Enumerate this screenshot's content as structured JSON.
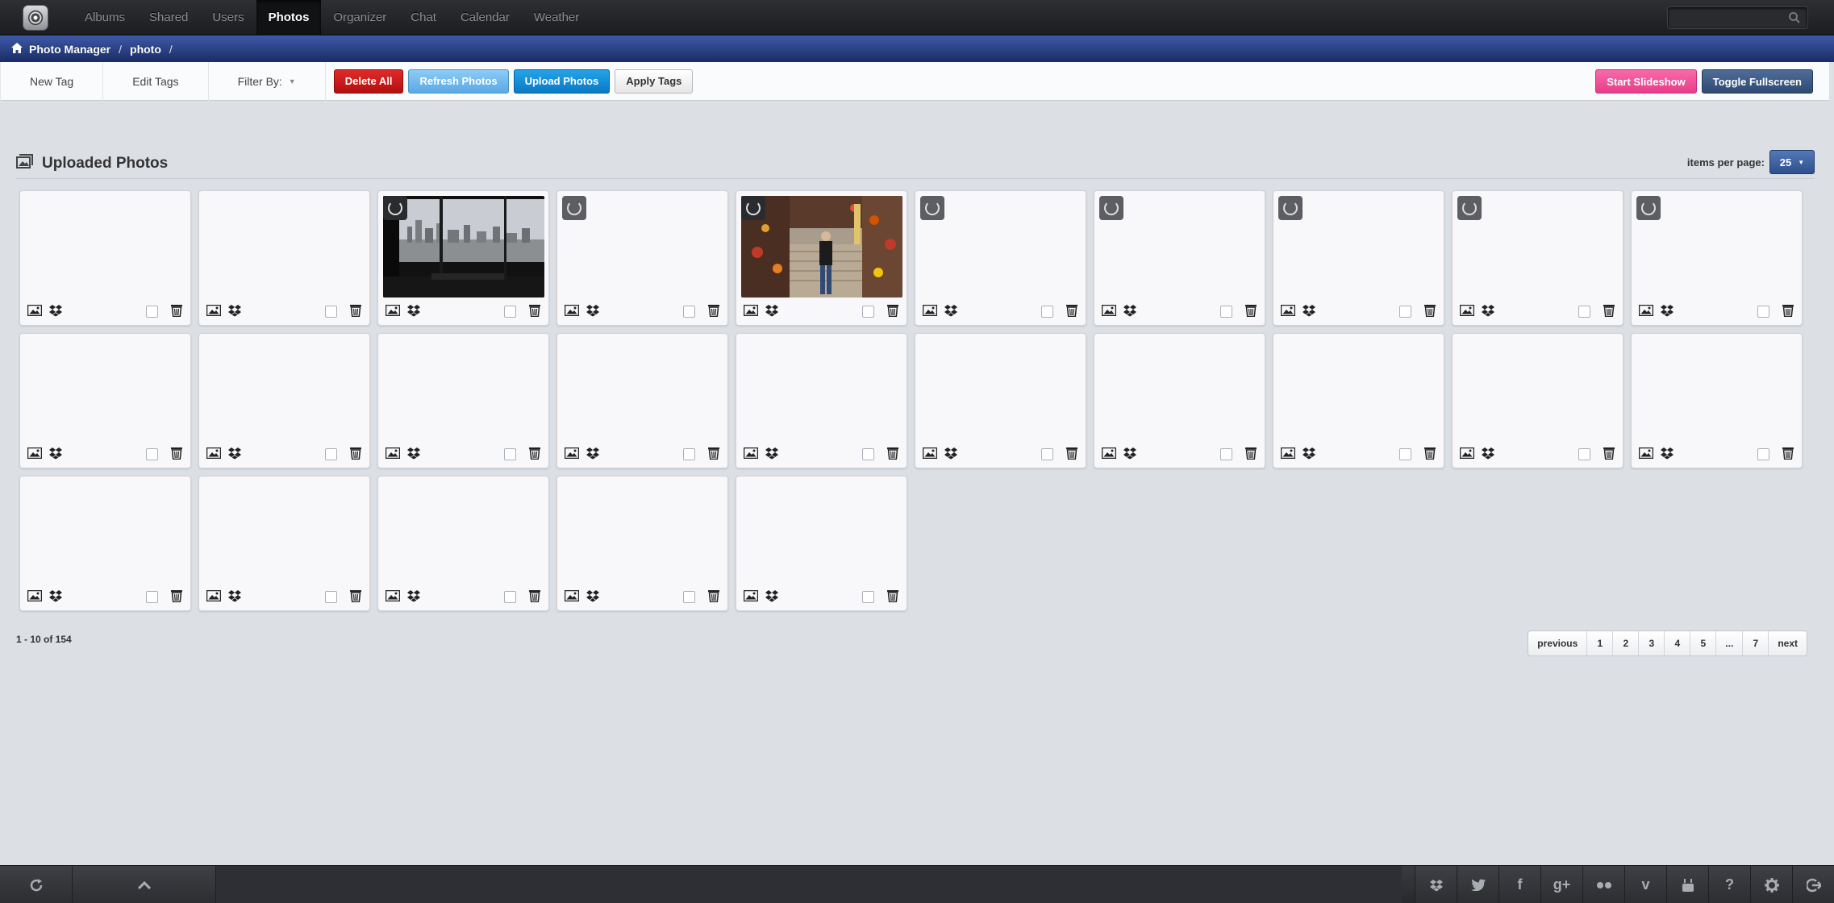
{
  "nav": {
    "items": [
      {
        "label": "Albums",
        "active": false
      },
      {
        "label": "Shared",
        "active": false
      },
      {
        "label": "Users",
        "active": false
      },
      {
        "label": "Photos",
        "active": true
      },
      {
        "label": "Organizer",
        "active": false
      },
      {
        "label": "Chat",
        "active": false
      },
      {
        "label": "Calendar",
        "active": false
      },
      {
        "label": "Weather",
        "active": false
      }
    ],
    "search_value": ""
  },
  "breadcrumb": {
    "root": "Photo Manager",
    "current": "photo",
    "sep": "/"
  },
  "toolbar": {
    "new_tag": "New Tag",
    "edit_tags": "Edit Tags",
    "filter_by": "Filter By:",
    "delete_all": "Delete All",
    "refresh_photos": "Refresh Photos",
    "upload_photos": "Upload Photos",
    "apply_tags": "Apply Tags",
    "start_slideshow": "Start Slideshow",
    "toggle_fullscreen": "Toggle Fullscreen"
  },
  "section": {
    "title": "Uploaded Photos",
    "items_per_page_label": "items per page:",
    "items_per_page_value": "25"
  },
  "cards": [
    {
      "state": "empty"
    },
    {
      "state": "empty"
    },
    {
      "state": "photo-harbor"
    },
    {
      "state": "loading"
    },
    {
      "state": "photo-street"
    },
    {
      "state": "loading"
    },
    {
      "state": "loading"
    },
    {
      "state": "loading"
    },
    {
      "state": "loading"
    },
    {
      "state": "loading"
    },
    {
      "state": "empty"
    },
    {
      "state": "empty"
    },
    {
      "state": "empty"
    },
    {
      "state": "empty"
    },
    {
      "state": "empty"
    },
    {
      "state": "empty"
    },
    {
      "state": "empty"
    },
    {
      "state": "empty"
    },
    {
      "state": "empty"
    },
    {
      "state": "empty"
    },
    {
      "state": "empty"
    },
    {
      "state": "empty"
    },
    {
      "state": "empty"
    },
    {
      "state": "empty"
    },
    {
      "state": "empty"
    }
  ],
  "range_text": "1 - 10 of 154",
  "pagination": [
    "previous",
    "1",
    "2",
    "3",
    "4",
    "5",
    "...",
    "7",
    "next"
  ],
  "footer": {
    "left_buttons": [
      "refresh-icon",
      "chevron-up-icon"
    ],
    "social_icons": [
      "dropbox-icon",
      "twitter-icon",
      "facebook-icon",
      "google-plus-icon",
      "flickr-icon",
      "vimeo-icon",
      "youtube-icon",
      "help-icon",
      "settings-icon",
      "logout-icon"
    ],
    "social_glyphs": [
      "",
      "",
      "f",
      "g+",
      "",
      "v",
      "",
      "?",
      "",
      ""
    ]
  },
  "colors": {
    "brand_blue": "#2e4f8d",
    "danger": "#c21818",
    "primary": "#0a79c5",
    "pink": "#e93d89"
  }
}
